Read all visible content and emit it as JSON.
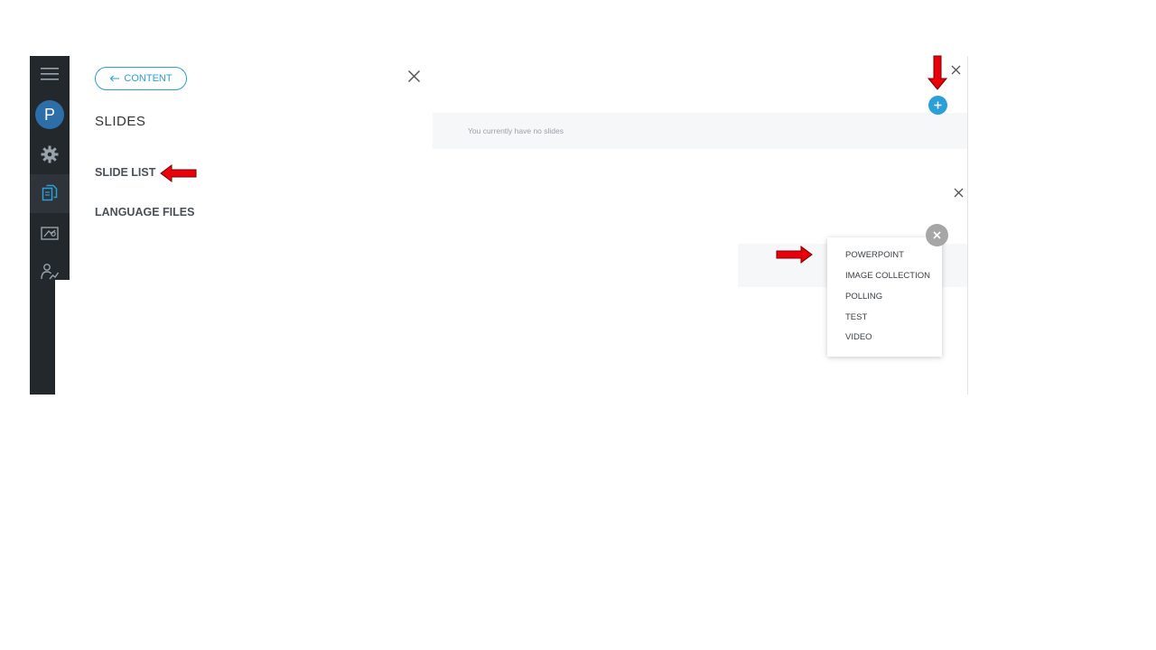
{
  "sidebar": {
    "avatar_letter": "P",
    "items": [
      {
        "icon": "hamburger-icon"
      },
      {
        "icon": "avatar"
      },
      {
        "icon": "gear-icon"
      },
      {
        "icon": "content-icon",
        "active": true
      },
      {
        "icon": "presentation-icon"
      },
      {
        "icon": "analytics-icon"
      }
    ]
  },
  "content_panel": {
    "back_label": "CONTENT",
    "title": "SLIDES",
    "nav": [
      {
        "label": "SLIDE LIST"
      },
      {
        "label": "LANGUAGE FILES"
      }
    ]
  },
  "slides_panel": {
    "empty_text": "You currently have no slides"
  },
  "add_menu": {
    "options": [
      {
        "label": "POWERPOINT"
      },
      {
        "label": "IMAGE COLLECTION"
      },
      {
        "label": "POLLING"
      },
      {
        "label": "TEST"
      },
      {
        "label": "VIDEO"
      }
    ]
  },
  "colors": {
    "accent": "#2a9fd8",
    "rail": "#23282d",
    "annotation": "#e8000b"
  }
}
